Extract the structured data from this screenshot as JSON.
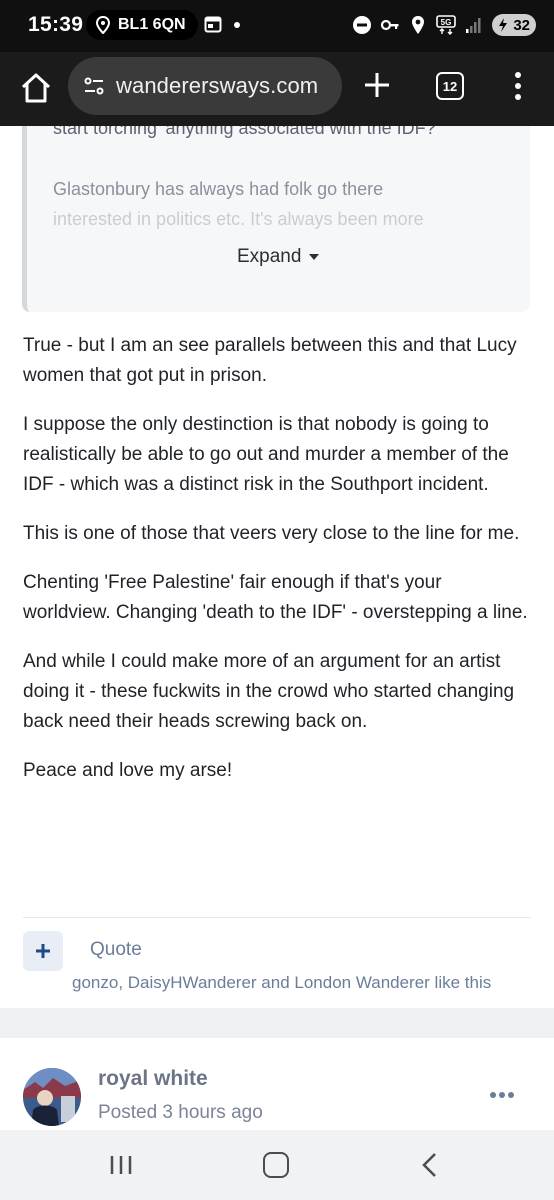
{
  "status_bar": {
    "time": "15:39",
    "location": "BL1 6QN",
    "battery": "32",
    "network": "5G",
    "icons": [
      "navigation-icon",
      "calendar-icon",
      "do-not-disturb-icon",
      "key-icon",
      "location-icon",
      "5g-icon",
      "signal-icon",
      "battery-icon"
    ]
  },
  "browser": {
    "url": "wanderersways.com",
    "tab_count": "12",
    "icons": [
      "home-icon",
      "tune-icon",
      "new-tab-icon",
      "tabs-icon",
      "more-vert-icon"
    ]
  },
  "quote_block": {
    "line1": "start torching 'anything associated with the IDF?",
    "line2": "Glastonbury has always had folk go there",
    "line3": "interested in politics etc. It's always been more",
    "expand_label": "Expand"
  },
  "post": {
    "paragraphs": [
      "True - but I am an see parallels between this and that Lucy women that got put in prison.",
      "I suppose the only destinction is that nobody is going to realistically be able to go out and murder a member of the IDF - which was a distinct risk in the Southport incident.",
      "This is one of those that veers very close to the line for me.",
      "Chenting 'Free Palestine' fair enough if that's your worldview. Changing 'death to the IDF' - overstepping a line.",
      "And while I could make more of an argument for an artist doing it - these fuckwits in the crowd who started changing back need their heads screwing back on.",
      "Peace and love my arse!"
    ],
    "quote_label": "Quote",
    "likes": "gonzo, DaisyHWanderer and London Wanderer like this"
  },
  "next_post": {
    "author": "royal white",
    "posted": "Posted 3 hours ago"
  },
  "colors": {
    "accent": "#1f4a8a",
    "link": "#6a7d99",
    "text": "#1f2328"
  }
}
